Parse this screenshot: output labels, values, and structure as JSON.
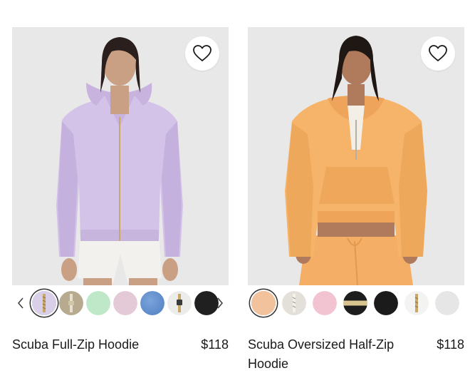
{
  "products": [
    {
      "name": "Scuba Full-Zip Hoodie",
      "price": "$118",
      "image_alt": "Woman wearing lavender full-zip hoodie and white shorts",
      "colors": {
        "garment": "#d4c3e8",
        "garment_shade": "#bfaad8",
        "bottom": "#f3f1ee",
        "skin": "#c9a083",
        "hair": "#2a1f1c",
        "zipper": "#c9a86a"
      },
      "swatches": [
        {
          "name": "lavender-zip",
          "color": "#d9cfe8",
          "pattern": "zip",
          "selected": true
        },
        {
          "name": "sand-zip",
          "color": "#b7aa8f",
          "pattern": "zip",
          "selected": false
        },
        {
          "name": "mint",
          "color": "#bfe8c9",
          "selected": false
        },
        {
          "name": "pink",
          "color": "#e3cad6",
          "selected": false
        },
        {
          "name": "heathered-blue",
          "color": "#5f8fcf",
          "selected": false
        },
        {
          "name": "white-zip",
          "color": "#ececea",
          "pattern": "zip-gold",
          "selected": false
        },
        {
          "name": "black",
          "color": "#202020",
          "selected": false
        }
      ]
    },
    {
      "name": "Scuba Oversized Half-Zip Hoodie",
      "price": "$118",
      "image_alt": "Woman wearing orange oversized half-zip hoodie and matching joggers",
      "colors": {
        "garment": "#f6b46a",
        "garment_shade": "#e9a154",
        "bottom": "#f4ae66",
        "skin": "#b07a5c",
        "hair": "#1f1714",
        "zipper": "#b5b0a6"
      },
      "swatches": [
        {
          "name": "peach",
          "color": "#f2c29c",
          "selected": true
        },
        {
          "name": "bone-zip",
          "color": "#e2e0d9",
          "pattern": "zip",
          "selected": false
        },
        {
          "name": "pink",
          "color": "#f2c4d1",
          "selected": false
        },
        {
          "name": "black-gold",
          "color": "#1d1d1d",
          "pattern": "split-gold",
          "selected": false
        },
        {
          "name": "black",
          "color": "#1b1b1b",
          "selected": false
        },
        {
          "name": "white-zip",
          "color": "#f3f3f1",
          "pattern": "zip-gold",
          "selected": false
        },
        {
          "name": "light-grey",
          "color": "#e6e6e6",
          "selected": false
        }
      ]
    }
  ],
  "icons": {
    "wishlist": "heart-outline-icon",
    "prev": "chevron-left-icon",
    "next": "chevron-right-icon"
  }
}
